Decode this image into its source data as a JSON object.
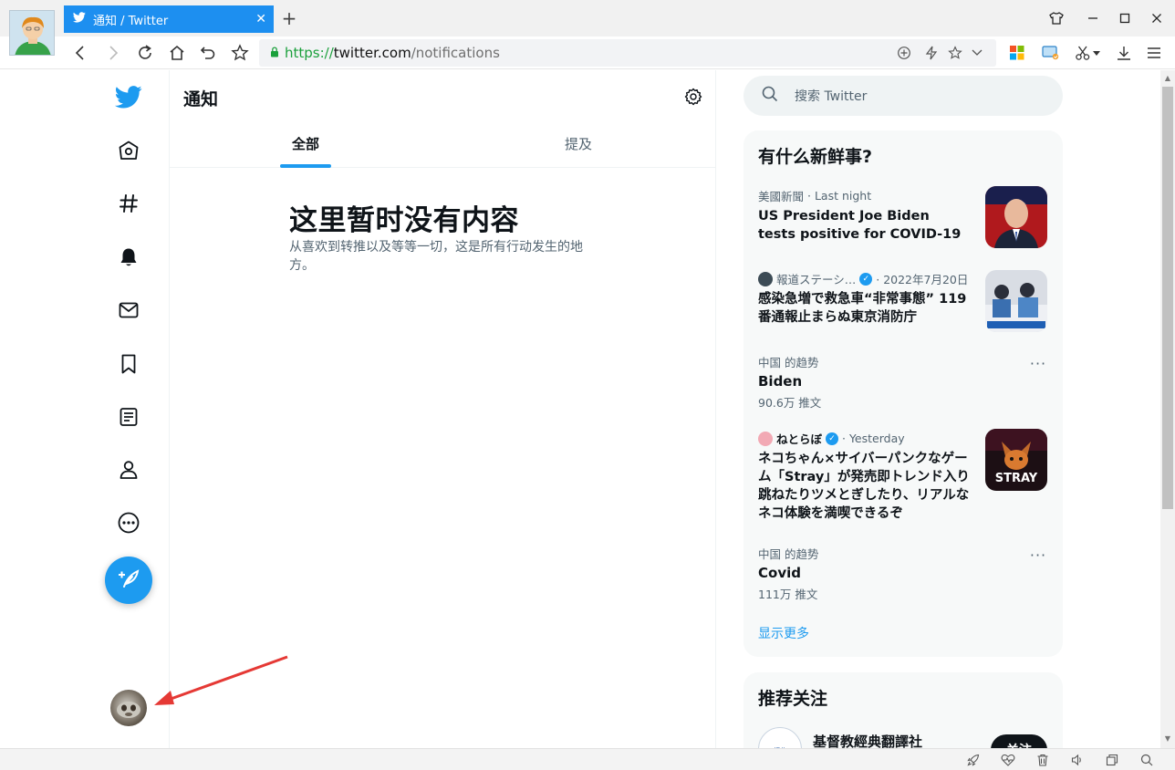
{
  "browser": {
    "tab_title": "通知 / Twitter",
    "tab_close": "✕",
    "new_tab": "+",
    "url_https": "https://",
    "url_host": "twitter.com",
    "url_path": "/notifications"
  },
  "main": {
    "title": "通知",
    "tabs": [
      {
        "label": "全部",
        "active": true
      },
      {
        "label": "提及",
        "active": false
      }
    ],
    "empty_title": "这里暂时没有内容",
    "empty_desc": "从喜欢到转推以及等等一切，这是所有行动发生的地方。"
  },
  "search": {
    "placeholder": "搜索 Twitter"
  },
  "whats_happening": {
    "title": "有什么新鲜事?",
    "items": [
      {
        "source": "美國新聞",
        "time": "· Last night",
        "headline": "US President Joe Biden tests positive for COVID-19"
      },
      {
        "source": "報道ステーシ…",
        "time": "· 2022年7月20日",
        "headline": "感染急増で救急車“非常事態” 119番通報止まらぬ東京消防庁"
      },
      {
        "context": "中国 的趋势",
        "name": "Biden",
        "count": "90.6万 推文"
      },
      {
        "source": "ねとらぼ",
        "time": "· Yesterday",
        "headline": "ネコちゃん×サイバーパンクなゲーム「Stray」が発売即トレンド入り　跳ねたりツメとぎしたり、リアルなネコ体験を満喫できるぞ"
      },
      {
        "context": "中国 的趋势",
        "name": "Covid",
        "count": "111万 推文"
      }
    ],
    "show_more": "显示更多"
  },
  "who_to_follow": {
    "title": "推荐关注",
    "first_name": "基督教經典翻譯社",
    "follow_label": "关注"
  },
  "colors": {
    "twitter_blue": "#1d9bf0",
    "tab_blue": "#1d8ff0",
    "arrow_red": "#e53935"
  }
}
